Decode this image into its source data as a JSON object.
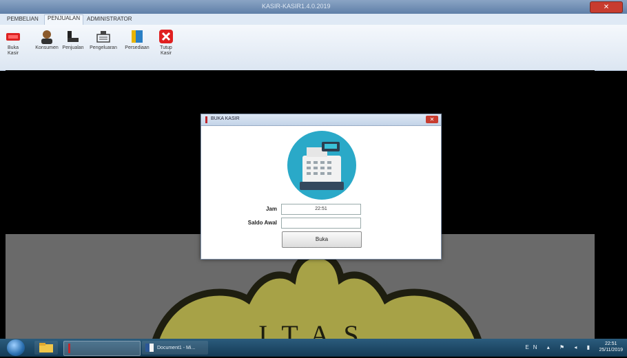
{
  "window": {
    "title": "KASIR-KASIR1.4.0.2019"
  },
  "menubar": {
    "tabs": [
      {
        "label": "PEMBELIAN",
        "active": false
      },
      {
        "label": "PENJUALAN",
        "active": true
      },
      {
        "label": "ADMINISTRATOR",
        "active": false
      }
    ]
  },
  "ribbon": {
    "buttons": [
      {
        "label": "Buka\nKasir",
        "icon": "open-register-icon"
      },
      {
        "label": "Konsumen",
        "icon": "customer-icon"
      },
      {
        "label": "Penjualan",
        "icon": "sales-icon"
      },
      {
        "label": "Pengeluaran",
        "icon": "expense-icon"
      },
      {
        "label": "Persediaan",
        "icon": "inventory-icon"
      },
      {
        "label": "Tutup\nKasir",
        "icon": "close-register-icon"
      }
    ]
  },
  "dialog": {
    "title": "BUKA KASIR",
    "fields": [
      {
        "label": "Jam",
        "value": "22:51"
      },
      {
        "label": "Saldo Awal",
        "value": ""
      }
    ],
    "button_label": "Buka"
  },
  "watermark": {
    "text": "ITAS"
  },
  "taskbar": {
    "items": [
      {
        "label": "",
        "icon": "explorer-icon"
      },
      {
        "label": "",
        "icon": "app-icon"
      },
      {
        "label": "Document1 - Mi...",
        "icon": "word-icon"
      }
    ],
    "tray_lang": "EN",
    "clock_time": "22:51",
    "clock_date": "25/11/2019"
  },
  "colors": {
    "accent_red": "#c0272d",
    "register_circle": "#2aa9c8"
  }
}
